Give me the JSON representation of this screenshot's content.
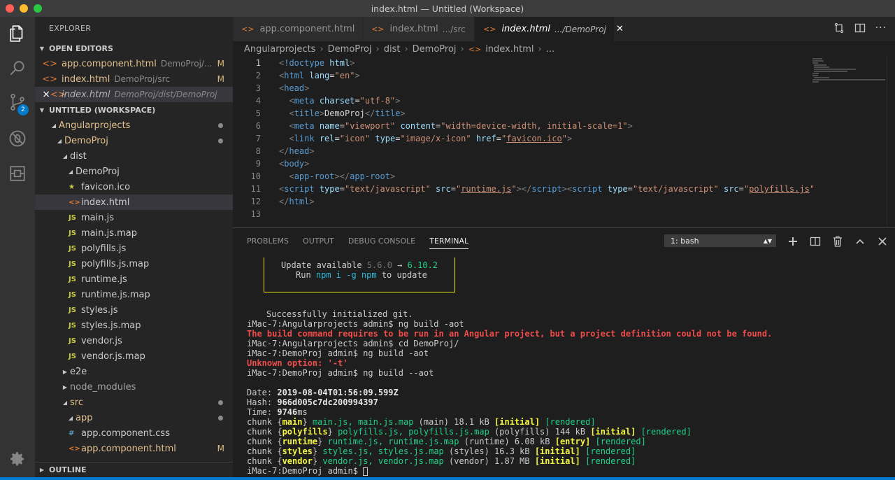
{
  "window": {
    "title": "index.html — Untitled (Workspace)"
  },
  "activity": {
    "scm_badge": "2"
  },
  "sidebar": {
    "title": "EXPLORER",
    "open_editors": {
      "header": "OPEN EDITORS",
      "items": [
        {
          "name": "app.component.html",
          "desc": "DemoProj/...",
          "mark": "M"
        },
        {
          "name": "index.html",
          "desc": "DemoProj/src",
          "mark": "M"
        },
        {
          "name": "index.html",
          "desc": "DemoProj/dist/DemoProj",
          "close": "×"
        }
      ]
    },
    "workspace": {
      "header": "UNTITLED (WORKSPACE)",
      "items": [
        {
          "name": "Angularprojects"
        },
        {
          "name": "DemoProj"
        },
        {
          "name": "dist"
        },
        {
          "name": "DemoProj"
        },
        {
          "name": "favicon.ico"
        },
        {
          "name": "index.html"
        },
        {
          "name": "main.js"
        },
        {
          "name": "main.js.map"
        },
        {
          "name": "polyfills.js"
        },
        {
          "name": "polyfills.js.map"
        },
        {
          "name": "runtime.js"
        },
        {
          "name": "runtime.js.map"
        },
        {
          "name": "styles.js"
        },
        {
          "name": "styles.js.map"
        },
        {
          "name": "vendor.js"
        },
        {
          "name": "vendor.js.map"
        },
        {
          "name": "e2e"
        },
        {
          "name": "node_modules"
        },
        {
          "name": "src"
        },
        {
          "name": "app"
        },
        {
          "name": "app.component.css"
        },
        {
          "name": "app.component.html",
          "mark": "M"
        }
      ]
    },
    "outline_header": "OUTLINE"
  },
  "tabs": [
    {
      "label": "app.component.html",
      "desc": ""
    },
    {
      "label": "index.html",
      "desc": ".../src"
    },
    {
      "label": "index.html",
      "desc": ".../DemoProj"
    }
  ],
  "breadcrumb": [
    "Angularprojects",
    "DemoProj",
    "dist",
    "DemoProj",
    "index.html",
    "..."
  ],
  "editor": {
    "line_numbers": [
      "1",
      "2",
      "3",
      "4",
      "5",
      "6",
      "7",
      "8",
      "9",
      "10",
      "11",
      "12",
      "13"
    ]
  },
  "panel": {
    "tabs": [
      "PROBLEMS",
      "OUTPUT",
      "DEBUG CONSOLE",
      "TERMINAL"
    ],
    "terminal_select": "1: bash",
    "terminal": {
      "update_1": "Update available ",
      "ver_old": "5.6.0",
      "arrow": " → ",
      "ver_new": "6.10.2",
      "update_2a": "Run ",
      "update_cmd": "npm i -g npm",
      "update_2b": " to update",
      "git": "Successfully initialized git.",
      "l1": "iMac-7:Angularprojects admin$ ng build -aot",
      "err1": "The build command requires to be run in an Angular project, but a project definition could not be found.",
      "l2": "iMac-7:Angularprojects admin$ cd DemoProj/",
      "l3": "iMac-7:DemoProj admin$ ng build -aot",
      "err2": "Unknown option: '-t'",
      "l4": "iMac-7:DemoProj admin$ ng build --aot",
      "date_label": "Date: ",
      "date_val": "2019-08-04T01:56:09.599Z",
      "hash_label": "Hash: ",
      "hash_val": "966d005c7dc200994397",
      "time_label": "Time: ",
      "time_val": "9746",
      "time_unit": "ms",
      "prompt": "iMac-7:DemoProj admin$ "
    }
  }
}
